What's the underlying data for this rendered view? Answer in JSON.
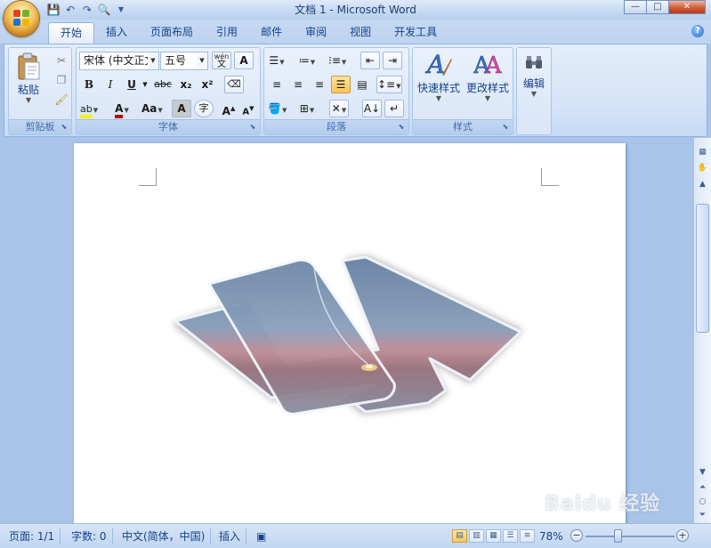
{
  "window": {
    "title": "文档 1 - Microsoft Word",
    "controls": {
      "minimize": "—",
      "maximize": "□",
      "close": "✕"
    }
  },
  "quick_access": [
    "save-icon",
    "undo-icon",
    "redo-icon",
    "print-preview-icon",
    "customize-icon"
  ],
  "tabs": [
    {
      "label": "开始",
      "active": true
    },
    {
      "label": "插入"
    },
    {
      "label": "页面布局"
    },
    {
      "label": "引用"
    },
    {
      "label": "邮件"
    },
    {
      "label": "审阅"
    },
    {
      "label": "视图"
    },
    {
      "label": "开发工具"
    }
  ],
  "help": "?",
  "ribbon": {
    "clipboard": {
      "label": "剪贴板",
      "paste": "粘贴"
    },
    "font": {
      "label": "字体",
      "font_name": "宋体 (中文正文)",
      "font_size": "五号",
      "bold": "B",
      "italic": "I",
      "underline": "U",
      "strikethrough": "abc",
      "subscript": "x₂",
      "superscript": "x²",
      "case": "Aa",
      "char_shading": "A",
      "enclose": "字",
      "grow": "A",
      "shrink": "A",
      "phonetic": "wén",
      "char_border": "A"
    },
    "paragraph": {
      "label": "段落"
    },
    "styles": {
      "label": "样式",
      "quick_styles": "快速样式",
      "change_styles": "更改样式"
    },
    "editing": {
      "label": "编辑"
    }
  },
  "statusbar": {
    "page": "页面: 1/1",
    "words": "字数: 0",
    "language": "中文(简体，中国)",
    "mode": "插入",
    "zoom": "78%"
  },
  "watermark": "Baidu 经验",
  "colors": {
    "accent": "#15428b",
    "ribbon_bg": "#dbe7f8",
    "workspace": "#a9c4e8"
  }
}
